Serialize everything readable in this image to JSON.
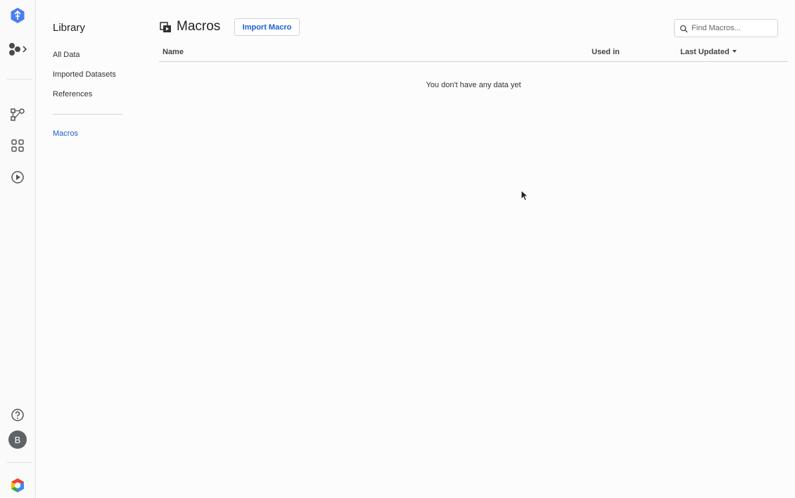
{
  "rail": {
    "icons": [
      "product-logo-icon",
      "flow-switcher-icon",
      "flow-icon",
      "grid-icon",
      "play-icon",
      "help-icon",
      "cloud-logo-icon"
    ],
    "avatar_initial": "B"
  },
  "library": {
    "title": "Library",
    "items": [
      {
        "label": "All Data"
      },
      {
        "label": "Imported Datasets"
      },
      {
        "label": "References"
      },
      {
        "label": "Macros",
        "active": true
      }
    ]
  },
  "header": {
    "title": "Macros",
    "import_label": "Import Macro"
  },
  "search": {
    "placeholder": "Find Macros..."
  },
  "table": {
    "columns": [
      "Name",
      "Used in",
      "Last Updated"
    ],
    "sort_column": "Last Updated",
    "empty_message": "You don't have any data yet"
  },
  "colors": {
    "accent": "#1a5fd6",
    "logo_blue": "#4a7ef0"
  }
}
